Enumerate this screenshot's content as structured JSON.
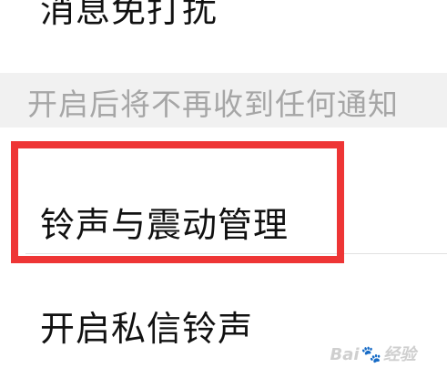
{
  "settings": {
    "do_not_disturb_label": "消息免打扰",
    "do_not_disturb_hint": "开启后将不再收到任何通知",
    "ringtone_vibration_label": "铃声与震动管理",
    "private_message_ringtone_label": "开启私信铃声"
  },
  "annotation": {
    "highlight_color": "#ee3535"
  },
  "watermark": {
    "brand_left": "Bai",
    "brand_right": "经验",
    "brand_icon": "paw-icon"
  }
}
